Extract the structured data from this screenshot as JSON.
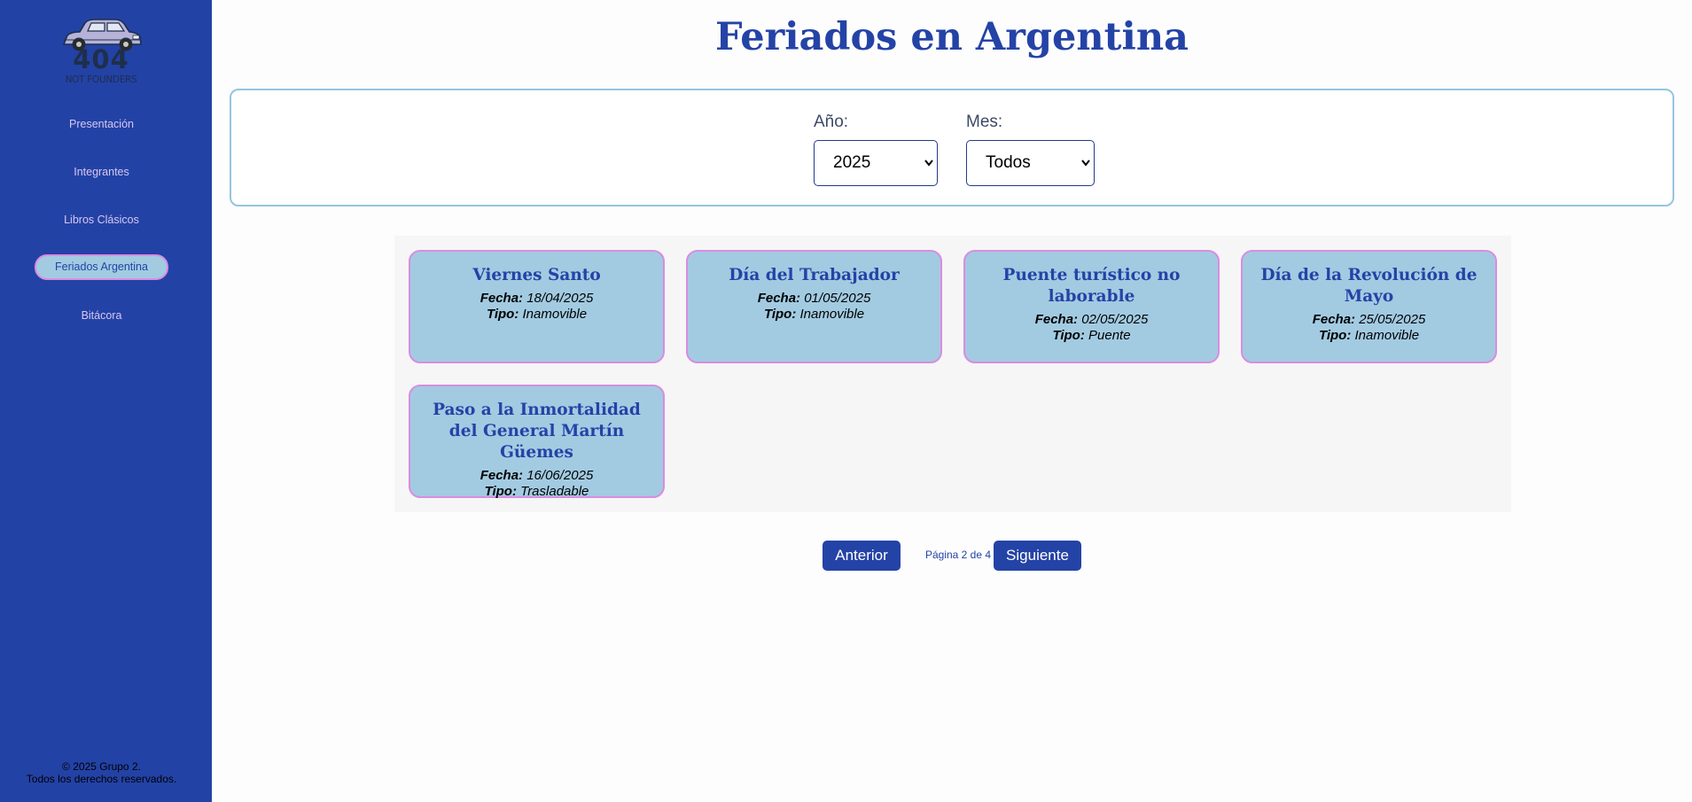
{
  "sidebar": {
    "logo": {
      "main": "404",
      "sub": "NOT FOUNDERS"
    },
    "items": [
      {
        "label": "Presentación"
      },
      {
        "label": "Integrantes"
      },
      {
        "label": "Libros Clásicos"
      },
      {
        "label": "Feriados Argentina",
        "active": true
      },
      {
        "label": "Bitácora"
      }
    ],
    "footer": {
      "line1": "© 2025 Grupo 2.",
      "line2": "Todos los derechos reservados."
    }
  },
  "header": {
    "title": "Feriados en Argentina"
  },
  "filters": {
    "year": {
      "label": "Año:",
      "value": "2025"
    },
    "month": {
      "label": "Mes:",
      "value": "Todos"
    }
  },
  "card_labels": {
    "fecha": "Fecha:",
    "tipo": "Tipo:"
  },
  "holidays": [
    {
      "title": "Viernes Santo",
      "fecha": "18/04/2025",
      "tipo": "Inamovible"
    },
    {
      "title": "Día del Trabajador",
      "fecha": "01/05/2025",
      "tipo": "Inamovible"
    },
    {
      "title": "Puente turístico no laborable",
      "fecha": "02/05/2025",
      "tipo": "Puente"
    },
    {
      "title": "Día de la Revolución de Mayo",
      "fecha": "25/05/2025",
      "tipo": "Inamovible"
    },
    {
      "title": "Paso a la Inmortalidad del General Martín Güemes",
      "fecha": "16/06/2025",
      "tipo": "Trasladable"
    }
  ],
  "pagination": {
    "prev": "Anterior",
    "indicator": "Página 2 de 4",
    "next": "Siguiente"
  },
  "colors": {
    "sidebar_bg": "#2342a6",
    "accent": "#2443a6",
    "card_bg": "#a2cbe2",
    "card_border": "#d98ce0"
  }
}
